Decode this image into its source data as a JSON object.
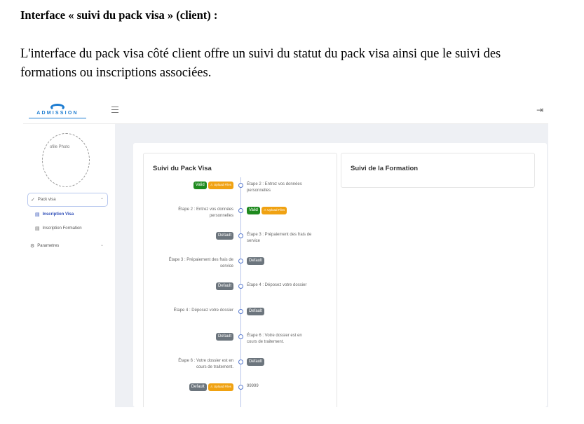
{
  "document": {
    "heading": "Interface « suivi du pack visa » (client) :",
    "paragraph": "L'interface du pack visa côté client offre un suivi du statut du pack visa ainsi que le suivi des formations ou inscriptions associées."
  },
  "app": {
    "logo_text": "ADMISSION",
    "menu_icon": "hamburger-icon",
    "logout_icon": "logout-icon",
    "colors": {
      "accent": "#3150b8",
      "valid": "#1e8a1e",
      "default": "#6c757d",
      "upload": "#f0a212"
    }
  },
  "sidebar": {
    "photo_label": "ofile Photo",
    "pack_visa": "Pack visa",
    "inscription_visa": "Inscription Visa",
    "inscription_formation": "Inscription Formation",
    "parametres": "Parametres"
  },
  "panels": {
    "visa_title": "Suivi du Pack Visa",
    "formation_title": "Suivi de la Formation"
  },
  "timeline": [
    {
      "side": "left",
      "text": "",
      "badges": [
        "Valid",
        "⚠ Upload Files"
      ]
    },
    {
      "side": "right",
      "text": "Étape 2 : Entrez vos données personnelles",
      "badges": []
    },
    {
      "side": "left",
      "text": "Étape 2 : Entrez vos données personnelles",
      "badges": []
    },
    {
      "side": "right",
      "text": "",
      "badges": [
        "Valid",
        "⚠ Upload Files"
      ]
    },
    {
      "side": "left",
      "text": "",
      "badges": [
        "Default"
      ]
    },
    {
      "side": "right",
      "text": "Étape 3 : Prépaiement des frais de service",
      "badges": []
    },
    {
      "side": "left",
      "text": "Étape 3 : Prépaiement des frais de service",
      "badges": []
    },
    {
      "side": "right",
      "text": "",
      "badges": [
        "Default"
      ]
    },
    {
      "side": "left",
      "text": "",
      "badges": [
        "Default"
      ]
    },
    {
      "side": "right",
      "text": "Étape 4 : Déposez votre dossier",
      "badges": []
    },
    {
      "side": "left",
      "text": "Étape 4 : Déposez votre dossier",
      "badges": []
    },
    {
      "side": "right",
      "text": "",
      "badges": [
        "Default"
      ]
    },
    {
      "side": "left",
      "text": "",
      "badges": [
        "Default"
      ]
    },
    {
      "side": "right",
      "text": "Étape 6 : Votre dossier est en cours de traitement.",
      "badges": []
    },
    {
      "side": "left",
      "text": "Étape 6 : Votre dossier est en cours de traitement.",
      "badges": []
    },
    {
      "side": "right",
      "text": "",
      "badges": [
        "Default"
      ]
    },
    {
      "side": "left",
      "text": "",
      "badges": [
        "Default",
        "⚠ Upload Files"
      ]
    },
    {
      "side": "right",
      "text": "99999",
      "badges": []
    }
  ]
}
